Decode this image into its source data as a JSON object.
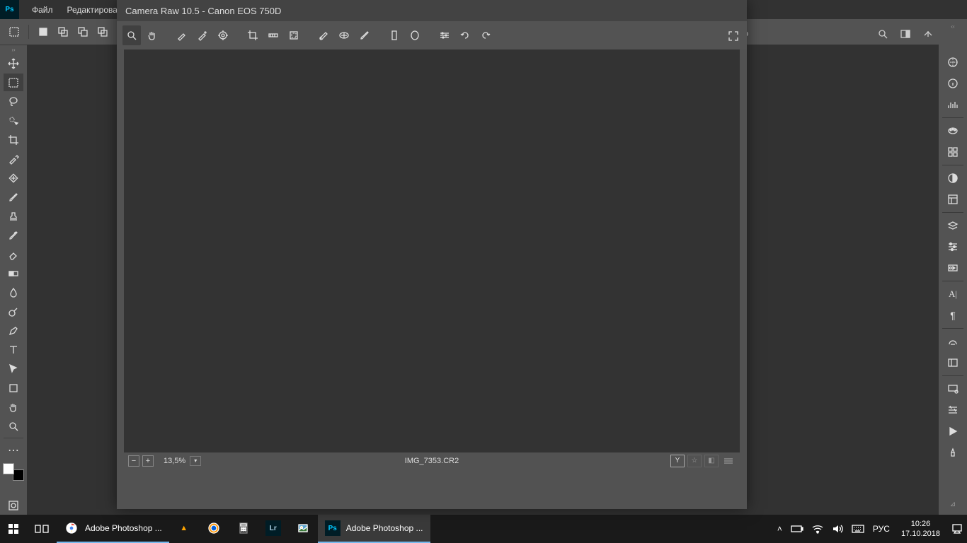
{
  "menubar": {
    "items": [
      "Файл",
      "Редактирован"
    ]
  },
  "camera_raw": {
    "title": "Camera Raw 10.5  -  Canon EOS 750D",
    "zoom": "13,5%",
    "filename": "IMG_7353.CR2"
  },
  "taskbar": {
    "apps": [
      {
        "label": "Adobe Photoshop ...",
        "icon": "chrome"
      },
      {
        "label": "",
        "icon": "amd"
      },
      {
        "label": "",
        "icon": "firefox"
      },
      {
        "label": "",
        "icon": "calculator"
      },
      {
        "label": "",
        "icon": "lightroom"
      },
      {
        "label": "",
        "icon": "pictures"
      },
      {
        "label": "Adobe Photoshop ...",
        "icon": "ps"
      }
    ],
    "lang": "РУС",
    "time": "10:26",
    "date": "17.10.2018"
  }
}
